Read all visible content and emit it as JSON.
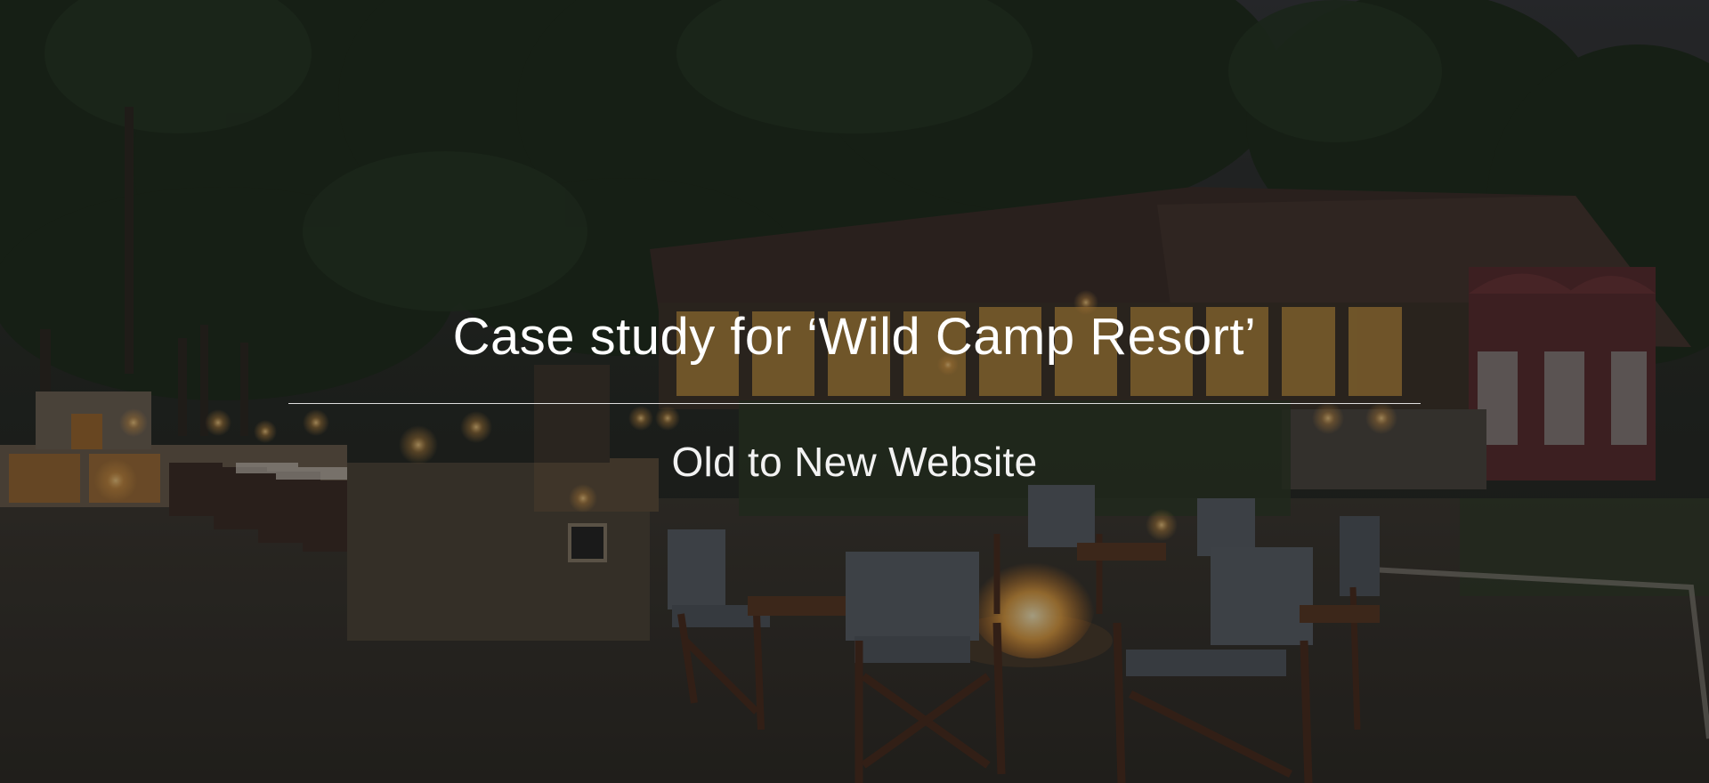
{
  "hero": {
    "title": "Case study for ‘Wild Camp Resort’",
    "subtitle": "Old to New Website",
    "background_image": "night-resort-courtyard-photo"
  },
  "colors": {
    "text": "#ffffff",
    "overlay": "#0c0c0c",
    "divider": "#ffffff"
  }
}
